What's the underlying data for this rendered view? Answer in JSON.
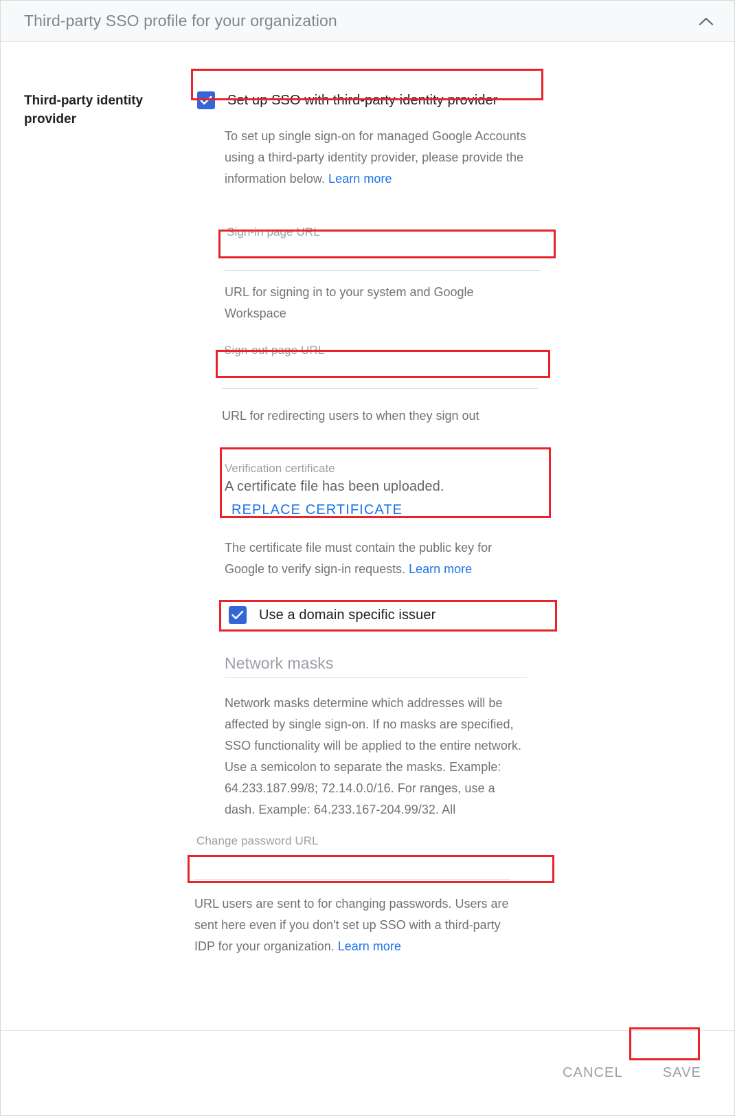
{
  "header": {
    "title": "Third-party SSO profile for your organization",
    "collapse_icon": "chevron-up-icon"
  },
  "section": {
    "label": "Third-party identity provider"
  },
  "sso_checkbox": {
    "label": "Set up SSO with third-party identity provider",
    "checked": true,
    "icon": "checkmark-icon"
  },
  "intro": {
    "text": "To set up single sign-on for managed Google Accounts using a third-party identity provider, please provide the information below. ",
    "link": "Learn more"
  },
  "signin_field": {
    "label": "Sign-in page URL",
    "value": "",
    "placeholder": "",
    "help": "URL for signing in to your system and Google Workspace"
  },
  "signout_field": {
    "label": "Sign-out page URL",
    "value": "",
    "placeholder": "",
    "help": "URL for redirecting users to when they sign out"
  },
  "certificate": {
    "label": "Verification certificate",
    "status": "A certificate file has been uploaded.",
    "button": "REPLACE CERTIFICATE",
    "help_text": "The certificate file must contain the public key for Google to verify sign-in requests. ",
    "help_link": "Learn more"
  },
  "issuer_checkbox": {
    "label": "Use a domain specific issuer",
    "checked": true,
    "icon": "checkmark-icon"
  },
  "network_masks": {
    "heading": "Network masks",
    "description": "Network masks determine which addresses will be affected by single sign-on. If no masks are specified, SSO functionality will be applied to the entire network. Use a semicolon to separate the masks. Example: 64.233.187.99/8; 72.14.0.0/16. For ranges, use a dash. Example: 64.233.167-204.99/32. All"
  },
  "change_password_field": {
    "label": "Change password URL",
    "value": "",
    "placeholder": "",
    "help_text": "URL users are sent to for changing passwords. Users are sent here even if you don't set up SSO with a third-party IDP for your organization. ",
    "help_link": "Learn more"
  },
  "footer": {
    "cancel_label": "CANCEL",
    "save_label": "SAVE"
  },
  "colors": {
    "accent_blue": "#1a73e8",
    "checkbox_blue": "#3367d6",
    "annotation_red": "#e8232a",
    "header_bg": "#f8f9fa",
    "muted_text": "#9aa0a6",
    "body_text": "#6f7377"
  }
}
